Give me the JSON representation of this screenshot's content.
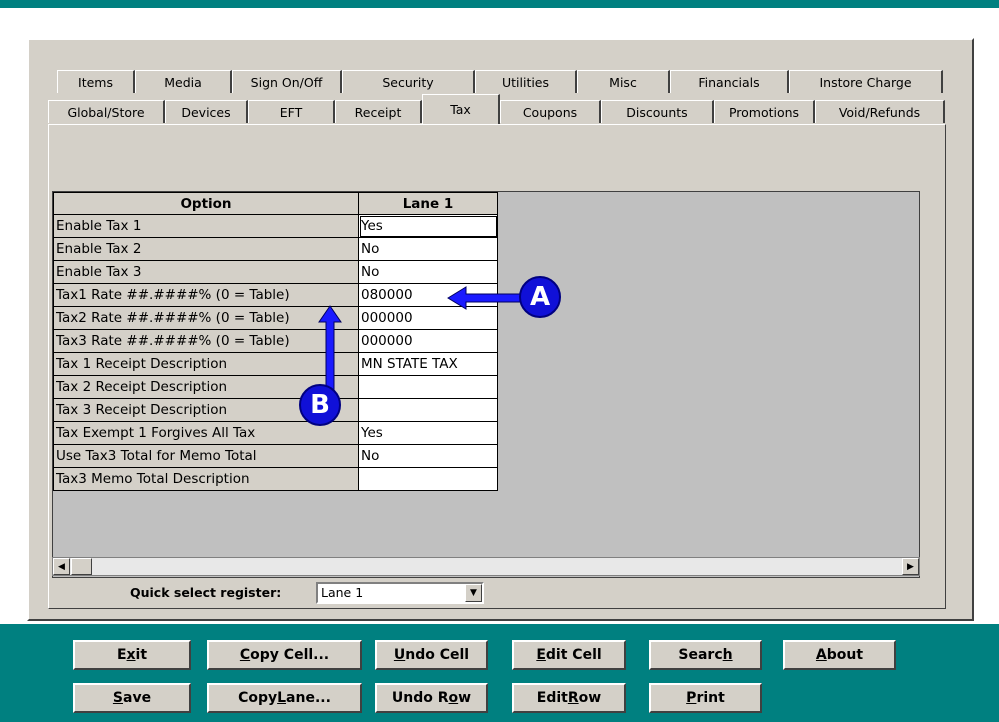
{
  "tabs_row1": [
    "Items",
    "Media",
    "Sign On/Off",
    "Security",
    "Utilities",
    "Misc",
    "Financials",
    "Instore Charge"
  ],
  "tabs_row2": [
    "Global/Store",
    "Devices",
    "EFT",
    "Receipt",
    "Tax",
    "Coupons",
    "Discounts",
    "Promotions",
    "Void/Refunds"
  ],
  "active_tab": "Tax",
  "grid": {
    "headers": {
      "option": "Option",
      "lane": "Lane 1"
    },
    "rows": [
      {
        "option": "Enable Tax 1",
        "value": "Yes"
      },
      {
        "option": "Enable Tax 2",
        "value": "No"
      },
      {
        "option": "Enable Tax 3",
        "value": "No"
      },
      {
        "option": "Tax1 Rate ##.####% (0 = Table)",
        "value": "080000"
      },
      {
        "option": "Tax2 Rate ##.####% (0 = Table)",
        "value": "000000"
      },
      {
        "option": "Tax3 Rate ##.####% (0 = Table)",
        "value": "000000"
      },
      {
        "option": "Tax 1 Receipt Description",
        "value": "MN STATE TAX"
      },
      {
        "option": "Tax 2 Receipt Description",
        "value": ""
      },
      {
        "option": "Tax 3 Receipt Description",
        "value": ""
      },
      {
        "option": "Tax Exempt 1 Forgives All Tax",
        "value": "Yes"
      },
      {
        "option": "Use Tax3 Total for Memo Total",
        "value": "No"
      },
      {
        "option": "Tax3 Memo Total Description",
        "value": ""
      }
    ]
  },
  "quick_select": {
    "label": "Quick select register:",
    "value": "Lane 1"
  },
  "buttons_row1": [
    {
      "pre": "E",
      "ul": "x",
      "post": "it"
    },
    {
      "pre": "",
      "ul": "C",
      "post": "opy Cell..."
    },
    {
      "pre": "",
      "ul": "U",
      "post": "ndo Cell"
    },
    {
      "pre": "",
      "ul": "E",
      "post": "dit Cell"
    },
    {
      "pre": "Searc",
      "ul": "h",
      "post": ""
    },
    {
      "pre": "",
      "ul": "A",
      "post": "bout"
    }
  ],
  "buttons_row2": [
    {
      "pre": "",
      "ul": "S",
      "post": "ave"
    },
    {
      "pre": "Copy ",
      "ul": "L",
      "post": "ane..."
    },
    {
      "pre": "Undo R",
      "ul": "o",
      "post": "w"
    },
    {
      "pre": "Edit ",
      "ul": "R",
      "post": "ow"
    },
    {
      "pre": "",
      "ul": "P",
      "post": "rint"
    }
  ],
  "callouts": {
    "a": "A",
    "b": "B"
  },
  "colors": {
    "teal": "#008080",
    "callout": "#1010d8",
    "arrow": "#1a1aff",
    "face": "#d4d0c8"
  }
}
